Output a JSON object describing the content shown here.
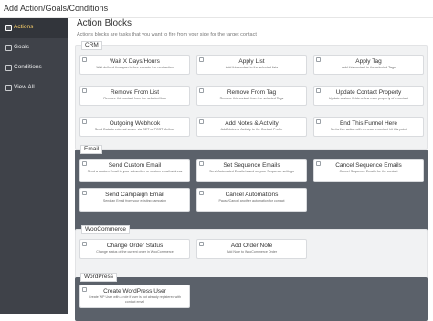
{
  "window": {
    "title": "Add Action/Goals/Conditions"
  },
  "sidebar": {
    "items": [
      {
        "label": "Actions",
        "icon": "actions-icon",
        "active": true
      },
      {
        "label": "Goals",
        "icon": "goals-icon",
        "active": false
      },
      {
        "label": "Conditions",
        "icon": "conditions-icon",
        "active": false
      },
      {
        "label": "View All",
        "icon": "view-all-icon",
        "active": false
      }
    ]
  },
  "main": {
    "title": "Action Blocks",
    "subtitle": "Actions blocks are tasks that you want to fire from your side for the target contact"
  },
  "sections": {
    "crm": {
      "label": "CRM",
      "cards": [
        {
          "title": "Wait X Days/Hours",
          "desc": "Wait defined timespan before execute the next action"
        },
        {
          "title": "Apply List",
          "desc": "Add this contact to the selected lists"
        },
        {
          "title": "Apply Tag",
          "desc": "Add this contact to the selected Tags"
        },
        {
          "title": "Remove From List",
          "desc": "Remove this contact from the selected lists"
        },
        {
          "title": "Remove From Tag",
          "desc": "Remove this contact from the selected Tags"
        },
        {
          "title": "Update Contact Property",
          "desc": "Update custom fields or few main property of a contact"
        },
        {
          "title": "Outgoing Webhook",
          "desc": "Send Data to external server via GET or POST Method"
        },
        {
          "title": "Add Notes & Activity",
          "desc": "Add Notes or Activity to the Contact Profile"
        },
        {
          "title": "End This Funnel Here",
          "desc": "No further action will run once a contact hit this point"
        }
      ]
    },
    "email": {
      "label": "Email",
      "cards": [
        {
          "title": "Send Custom Email",
          "desc": "Send a custom Email to your subscriber or custom email address"
        },
        {
          "title": "Set Sequence Emails",
          "desc": "Send Automated Emails based on your Sequence settings"
        },
        {
          "title": "Cancel Sequence Emails",
          "desc": "Cancel Sequence Emails for the contact"
        },
        {
          "title": "Send Campaign Email",
          "desc": "Send an Email from your existing campaign"
        },
        {
          "title": "Cancel Automations",
          "desc": "Pause/Cancel another automation for contact"
        }
      ]
    },
    "woocommerce": {
      "label": "WooCommerce",
      "cards": [
        {
          "title": "Change Order Status",
          "desc": "Change status of the current order in WooCommerce"
        },
        {
          "title": "Add Order Note",
          "desc": "Add Note to WooCommerce Order"
        }
      ]
    },
    "wordpress": {
      "label": "WordPress",
      "cards": [
        {
          "title": "Create WordPress User",
          "desc": "Create WP User with a role if user is not already registered with contact email"
        }
      ]
    }
  },
  "colors": {
    "sidebar_bg": "#3f4249",
    "sidebar_active_bg": "#32353b",
    "active_label": "#ffd36b",
    "dark_section_bg": "#5b616a",
    "light_section_bg": "#f1f2f3"
  }
}
